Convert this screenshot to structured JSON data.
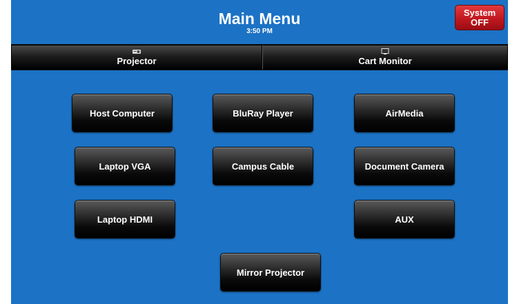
{
  "header": {
    "title": "Main Menu",
    "time": "3:50 PM"
  },
  "system_button": {
    "line1": "System",
    "line2": "OFF",
    "color": "#c0181f"
  },
  "displays": [
    {
      "label": "Projector",
      "icon": "projector-icon"
    },
    {
      "label": "Cart Monitor",
      "icon": "monitor-icon"
    }
  ],
  "sources": {
    "host_computer": "Host Computer",
    "bluray_player": "BluRay Player",
    "airmedia": "AirMedia",
    "laptop_vga": "Laptop VGA",
    "campus_cable": "Campus Cable",
    "document_camera": "Document Camera",
    "laptop_hdmi": "Laptop HDMI",
    "aux": "AUX",
    "mirror_projector": "Mirror Projector"
  },
  "colors": {
    "background": "#1c72c4",
    "button": "#000000",
    "text": "#ffffff"
  }
}
